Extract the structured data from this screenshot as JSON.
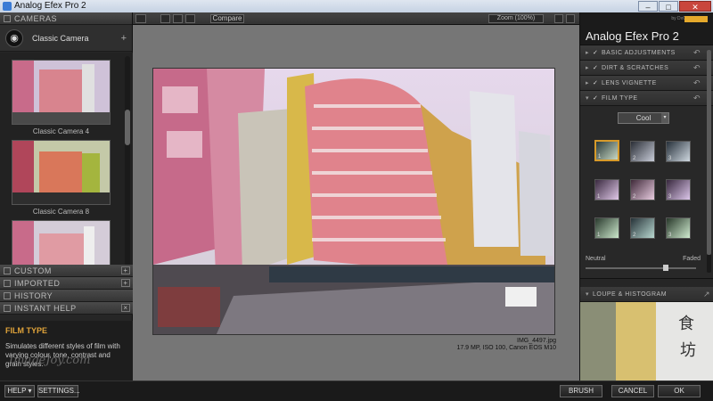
{
  "window": {
    "title": "Analog Efex Pro 2",
    "minimize": "–",
    "maximize": "□",
    "close": "✕"
  },
  "left": {
    "cameras_header": "CAMERAS",
    "selected_camera": "Classic Camera",
    "add_label": "+",
    "presets": [
      {
        "label": "Classic Camera 4"
      },
      {
        "label": "Classic Camera 8"
      },
      {
        "label": ""
      }
    ],
    "sections": [
      {
        "label": "CUSTOM"
      },
      {
        "label": "IMPORTED"
      },
      {
        "label": "HISTORY"
      },
      {
        "label": "INSTANT HELP"
      }
    ],
    "help_title": "FILM TYPE",
    "help_text": "Simulates different styles of film with varying colour, tone, contrast and grain styles.",
    "watermark": "ImageJoy.com"
  },
  "toolbar": {
    "compare_label": "Compare",
    "zoom_label": "Zoom (100%)"
  },
  "canvas": {
    "filename": "IMG_4497.jpg",
    "meta": "17.9 MP, ISO 100, Canon EOS M10"
  },
  "right": {
    "app_name": "Analog Efex Pro",
    "app_version": "2",
    "brand_sub": "by DxO",
    "filters": [
      {
        "label": "BASIC ADJUSTMENTS"
      },
      {
        "label": "DIRT & SCRATCHES"
      },
      {
        "label": "LENS VIGNETTE"
      },
      {
        "label": "FILM TYPE"
      }
    ],
    "film_select": "Cool",
    "swatch_numbers": [
      "1",
      "2",
      "3",
      "1",
      "2",
      "3",
      "1",
      "2",
      "3"
    ],
    "slider_left": "Neutral",
    "slider_right": "Faded",
    "slider_value_fraction": 0.74,
    "loupe_label": "LOUPE & HISTOGRAM"
  },
  "bottom": {
    "help": "HELP ▾",
    "settings": "SETTINGS...",
    "brush": "BRUSH",
    "cancel": "CANCEL",
    "ok": "OK"
  },
  "colors": {
    "accent": "#e5a92c",
    "selected_swatch": "#d79a2a"
  }
}
